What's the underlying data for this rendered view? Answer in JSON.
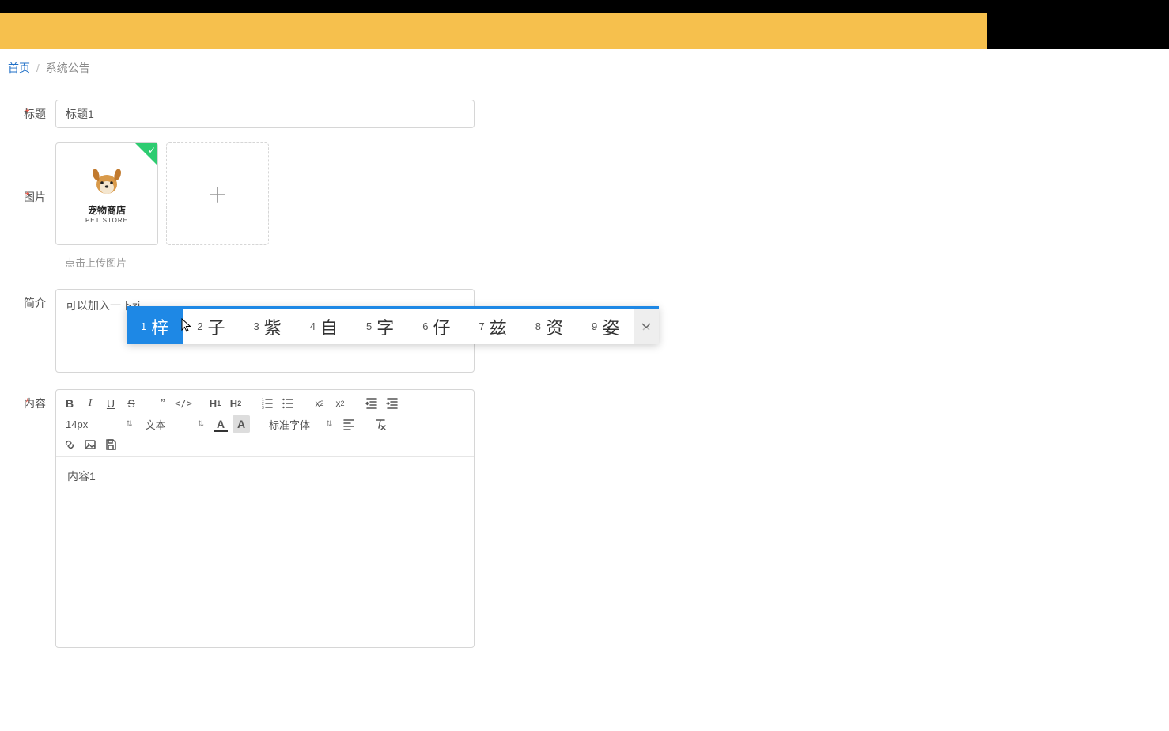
{
  "breadcrumb": {
    "home": "首页",
    "current": "系统公告"
  },
  "form": {
    "titleLabel": "标题",
    "titleValue": "标题1",
    "imageLabel": "图片",
    "petStoreTitle": "宠物商店",
    "petStoreSub": "PET STORE",
    "uploadHint": "点击上传图片",
    "briefLabel": "简介",
    "briefValue": "可以加入一下zi",
    "contentLabel": "内容",
    "contentValue": "内容1"
  },
  "ime": {
    "candidates": [
      {
        "num": "1",
        "char": "梓"
      },
      {
        "num": "2",
        "char": "子"
      },
      {
        "num": "3",
        "char": "紫"
      },
      {
        "num": "4",
        "char": "自"
      },
      {
        "num": "5",
        "char": "字"
      },
      {
        "num": "6",
        "char": "仔"
      },
      {
        "num": "7",
        "char": "兹"
      },
      {
        "num": "8",
        "char": "资"
      },
      {
        "num": "9",
        "char": "姿"
      }
    ]
  },
  "editor": {
    "fontSize": "14px",
    "blockType": "文本",
    "fontFamily": "标准字体"
  }
}
